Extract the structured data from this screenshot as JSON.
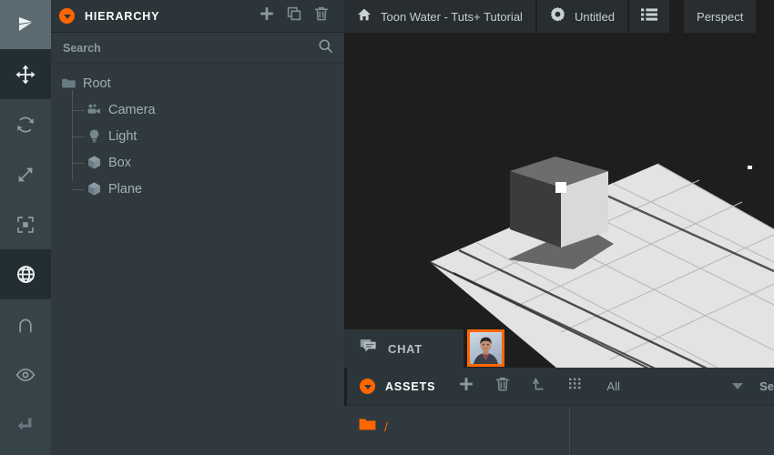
{
  "app": {
    "name": "playcanvas-editor"
  },
  "left_toolbar": {
    "items": [
      {
        "name": "logo",
        "icon": "playcanvas-logo-icon",
        "state": "logo"
      },
      {
        "name": "translate",
        "icon": "move-gizmo-icon",
        "state": "active"
      },
      {
        "name": "rotate",
        "icon": "rotate-gizmo-icon",
        "state": "idle"
      },
      {
        "name": "scale",
        "icon": "scale-gizmo-icon",
        "state": "idle"
      },
      {
        "name": "focus",
        "icon": "bounding-box-icon",
        "state": "idle"
      },
      {
        "name": "world-space",
        "icon": "globe-icon",
        "state": "active"
      },
      {
        "name": "snap",
        "icon": "magnet-icon",
        "state": "idle"
      },
      {
        "name": "visibility",
        "icon": "eye-icon",
        "state": "idle"
      },
      {
        "name": "history",
        "icon": "return-arrow-icon",
        "state": "disabled"
      }
    ]
  },
  "hierarchy": {
    "title": "HIERARCHY",
    "header_buttons": [
      {
        "name": "add-entity",
        "icon": "plus-icon"
      },
      {
        "name": "duplicate-entity",
        "icon": "copy-icon"
      },
      {
        "name": "delete-entity",
        "icon": "trash-icon"
      }
    ],
    "search": {
      "placeholder": "Search",
      "value": "",
      "icon": "search-icon"
    },
    "tree": [
      {
        "label": "Root",
        "icon": "folder-icon",
        "depth": 0
      },
      {
        "label": "Camera",
        "icon": "camera-icon",
        "depth": 1
      },
      {
        "label": "Light",
        "icon": "light-bulb-icon",
        "depth": 1
      },
      {
        "label": "Box",
        "icon": "cube-icon",
        "depth": 1
      },
      {
        "label": "Plane",
        "icon": "cube-icon",
        "depth": 1
      }
    ]
  },
  "top_bar": {
    "items": [
      {
        "name": "project-home",
        "label": "Toon Water - Tuts+ Tutorial",
        "icon": "home-icon"
      },
      {
        "name": "scene-settings",
        "label": "Untitled",
        "icon": "gear-icon"
      },
      {
        "name": "scene-list",
        "label": "",
        "icon": "list-icon"
      },
      {
        "name": "camera-mode",
        "label": "Perspect",
        "icon": ""
      }
    ]
  },
  "viewport": {
    "background_color": "#1e1e1e",
    "objects": [
      {
        "name": "plane",
        "type": "ground-grid-plane",
        "color": "#e2e2e2"
      },
      {
        "name": "box",
        "type": "cube",
        "color": "#d9d9d9"
      },
      {
        "name": "gizmo-handle",
        "type": "selection-dot",
        "color": "#ffffff"
      }
    ]
  },
  "chat": {
    "tab_label": "CHAT",
    "tab_icon": "chat-bubbles-icon",
    "avatar": {
      "name": "user-avatar",
      "border_color": "#ff6600"
    }
  },
  "assets": {
    "title": "ASSETS",
    "buttons": [
      {
        "name": "add-asset",
        "icon": "plus-icon"
      },
      {
        "name": "delete-asset",
        "icon": "trash-icon"
      },
      {
        "name": "upload-asset",
        "icon": "upload-icon"
      },
      {
        "name": "grid-view",
        "icon": "grid-icon"
      }
    ],
    "filter": {
      "label": "All",
      "caret": "chevron-down-icon"
    },
    "search_label": "Se",
    "items": [
      {
        "name": "root-folder",
        "label": "/",
        "icon": "folder-icon",
        "color": "#ff6600"
      }
    ]
  },
  "colors": {
    "accent": "#ff6600",
    "panel_bg": "#2f393e",
    "header_bg": "#2c3539",
    "toolbar_bg": "#364349",
    "viewport_bg": "#1e1e1e",
    "text_primary": "#ffffff",
    "text_secondary": "#9fb0b7"
  }
}
